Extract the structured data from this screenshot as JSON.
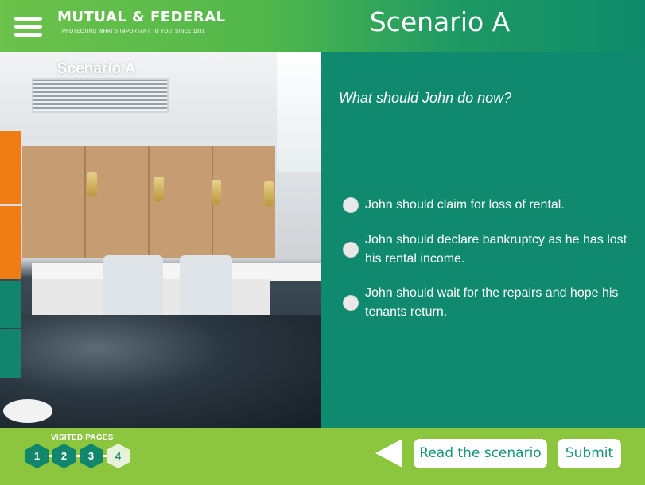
{
  "header": {
    "brand_name": "MUTUAL & FEDERAL",
    "brand_tagline": "PROTECTING WHAT'S IMPORTANT TO YOU. SINCE 1831",
    "title": "Scenario A",
    "menu_icon": "hamburger-menu-icon"
  },
  "scenario_image": {
    "caption": "Scenario A",
    "side_tab_colors": [
      "#f07d14",
      "#f07d14",
      "#12866d",
      "#12866d"
    ]
  },
  "question": {
    "prompt": "What should John do now?",
    "options": [
      {
        "label": "John should claim for loss of rental.",
        "selected": false
      },
      {
        "label": "John should declare bankruptcy as he has lost his rental income.",
        "selected": false
      },
      {
        "label": "John should wait for the repairs and hope his tenants return.",
        "selected": false
      }
    ]
  },
  "footer": {
    "visited_label": "VISITED PAGES",
    "pages": [
      {
        "number": "1",
        "visited": true
      },
      {
        "number": "2",
        "visited": true
      },
      {
        "number": "3",
        "visited": true
      },
      {
        "number": "4",
        "current": true
      }
    ],
    "back_icon": "back-arrow-icon",
    "read_scenario_label": "Read the scenario",
    "submit_label": "Submit"
  },
  "colors": {
    "header_green": "#6cc24a",
    "panel_teal": "#0f8a6f",
    "footer_green": "#8cc63f",
    "accent_orange": "#f07d14",
    "hex_dark": "#12866d",
    "hex_current": "#e6f3da"
  }
}
